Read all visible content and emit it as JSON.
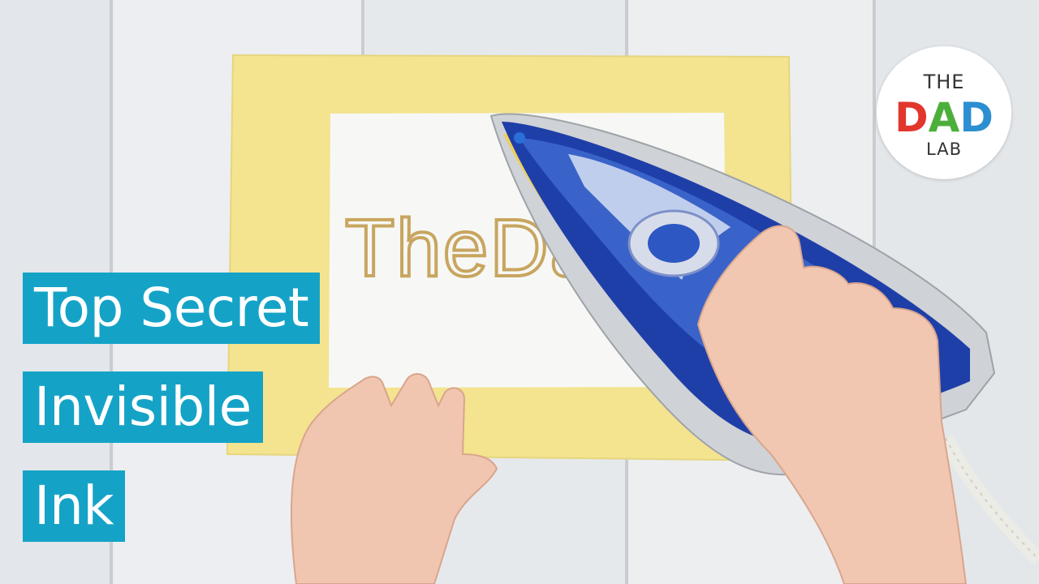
{
  "title": {
    "lines": [
      "Top Secret",
      "Invisible",
      "Ink"
    ],
    "background_color": "#14a3c7",
    "text_color": "#ffffff"
  },
  "logo": {
    "top_text": "THE",
    "middle_text_parts": [
      "D",
      "A",
      "D"
    ],
    "bottom_text": "LAB",
    "colors": {
      "d1": "#e2362c",
      "a": "#4caf3b",
      "d2": "#2b8fd1"
    }
  },
  "paper_text": "TheDa",
  "colors": {
    "planks": "#e9ecef",
    "yellow_paper": "#f4e38f",
    "white_paper": "#f7f8f5",
    "iron_blue": "#1f3fa8",
    "iron_grey": "#c9ccd1"
  }
}
